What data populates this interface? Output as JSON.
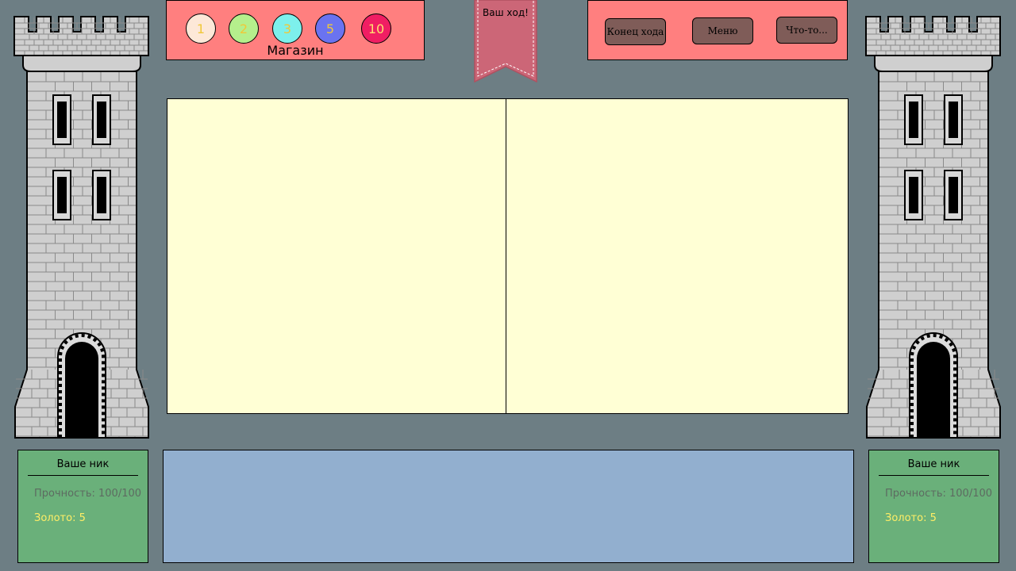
{
  "shop": {
    "title": "Магазин",
    "coins": [
      {
        "label": "1",
        "bg": "#fde8d8",
        "color": "#f0c838"
      },
      {
        "label": "2",
        "bg": "#b5ef8c",
        "color": "#f0c838"
      },
      {
        "label": "3",
        "bg": "#7df0ec",
        "color": "#f0c838"
      },
      {
        "label": "5",
        "bg": "#6a73f0",
        "color": "#f0c838"
      },
      {
        "label": "10",
        "bg": "#f01e63",
        "color": "#ffe070"
      }
    ]
  },
  "turn_banner": {
    "text": "Ваш ход!"
  },
  "actions": {
    "end_turn": "Конец хода",
    "menu": "Меню",
    "something": "Что-то..."
  },
  "players": {
    "left": {
      "name": "Ваше ник",
      "durability": "Прочность: 100/100",
      "gold": "Золото: 5"
    },
    "right": {
      "name": "Ваше ник",
      "durability": "Прочность: 100/100",
      "gold": "Золото: 5"
    }
  },
  "colors": {
    "background": "#6d7e84",
    "panel_red": "#ff7f7f",
    "board": "#ffffd5",
    "log": "#92afcf",
    "player_panel": "#6ab07a",
    "gold_text": "#ffee66"
  }
}
